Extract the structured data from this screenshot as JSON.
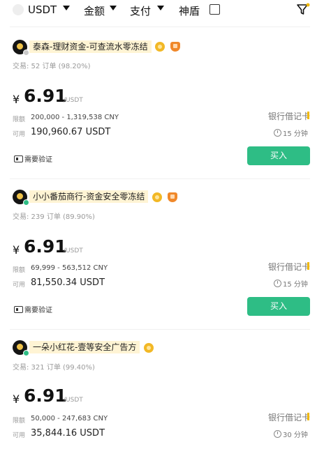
{
  "filters": {
    "coin": "USDT",
    "amount": "金额",
    "payment": "支付",
    "shield": "神盾"
  },
  "colors": {
    "buy": "#2ebd85",
    "accent": "#f0b90b",
    "online": "#2ebd85"
  },
  "ads": [
    {
      "merchant": "泰森-理财资金-可查流水零冻结",
      "online": false,
      "badges": [
        "gold-medal-icon",
        "shield-badge-icon"
      ],
      "stats": "交易: 52 订单 (98.20%)",
      "currency_symbol": "¥",
      "price": "6.91",
      "unit": "/USDT",
      "limit_label": "限额",
      "limit": "200,000 - 1,319,538 CNY",
      "available_label": "可用",
      "available": "190,960.67 USDT",
      "payment_method": "银行借记卡",
      "time_limit": "15 分钟",
      "verify": "需要验证",
      "button": "买入"
    },
    {
      "merchant": "小小番茄商行-资金安全零冻结",
      "online": true,
      "badges": [
        "gold-medal-icon",
        "shield-badge-icon"
      ],
      "stats": "交易: 239 订单 (89.90%)",
      "currency_symbol": "¥",
      "price": "6.91",
      "unit": "/USDT",
      "limit_label": "限额",
      "limit": "69,999 - 563,512 CNY",
      "available_label": "可用",
      "available": "81,550.34 USDT",
      "payment_method": "银行借记卡",
      "time_limit": "15 分钟",
      "verify": "需要验证",
      "button": "买入"
    },
    {
      "merchant": "一朵小红花-壹等安全广告方",
      "online": true,
      "badges": [
        "gold-medal-icon"
      ],
      "stats": "交易: 321 订单 (99.40%)",
      "currency_symbol": "¥",
      "price": "6.91",
      "unit": "/USDT",
      "limit_label": "限额",
      "limit": "50,000 - 247,683 CNY",
      "available_label": "可用",
      "available": "35,844.16 USDT",
      "payment_method": "银行借记卡",
      "time_limit": "30 分钟"
    }
  ]
}
